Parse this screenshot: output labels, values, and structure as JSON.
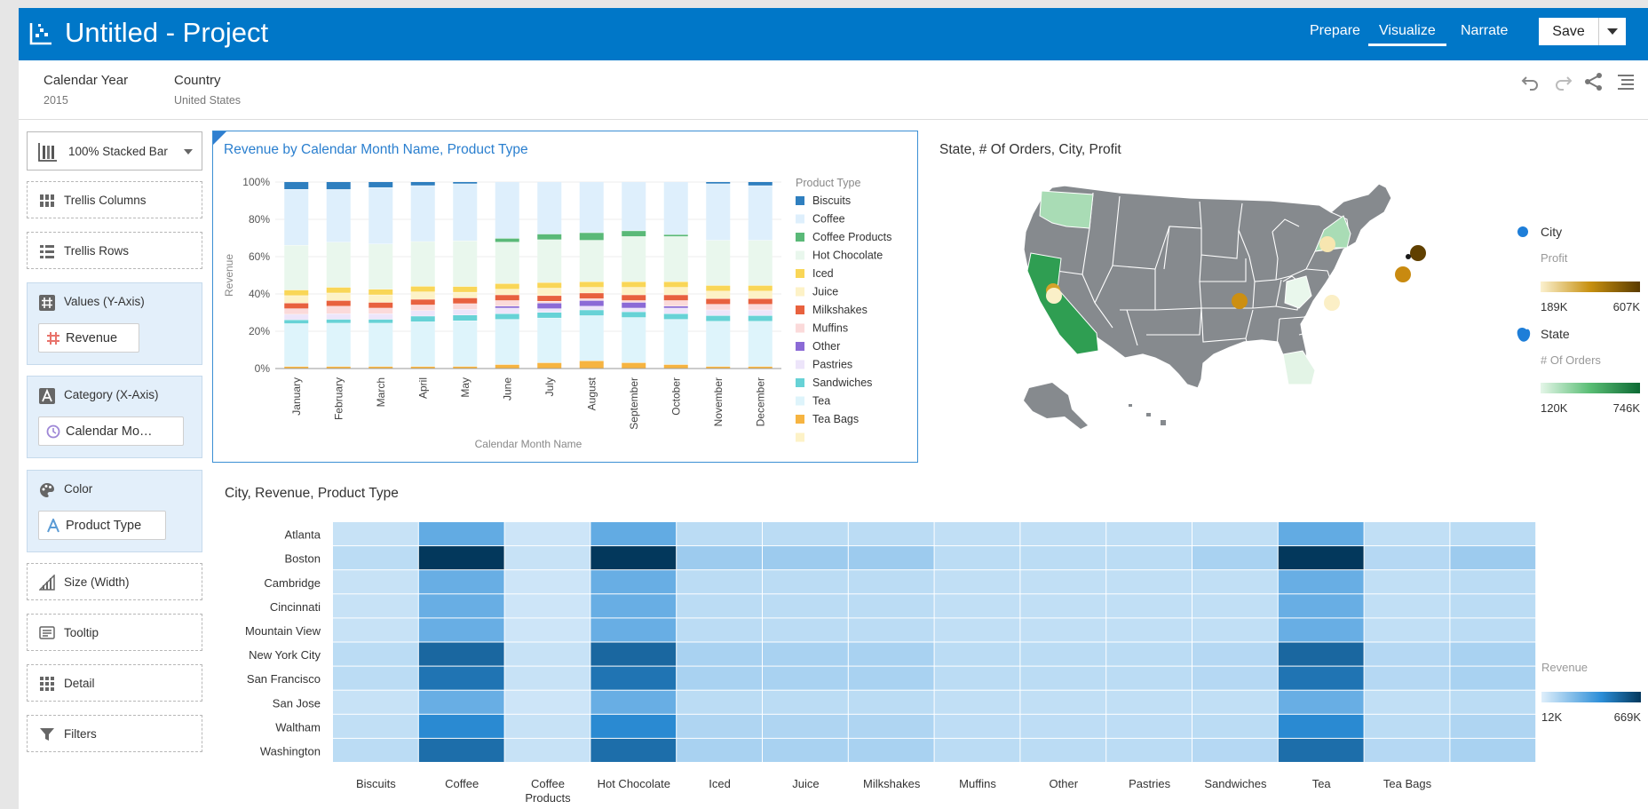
{
  "header": {
    "title": "Untitled - Project",
    "tabs": [
      "Prepare",
      "Visualize",
      "Narrate"
    ],
    "active_tab": "Visualize",
    "save_label": "Save"
  },
  "filters": [
    {
      "name": "Calendar Year",
      "value": "2015"
    },
    {
      "name": "Country",
      "value": "United States"
    }
  ],
  "grammar": {
    "viz_type": "100% Stacked Bar",
    "trellis_columns": "Trellis Columns",
    "trellis_rows": "Trellis Rows",
    "values_label": "Values (Y-Axis)",
    "values_item": "Revenue",
    "category_label": "Category (X-Axis)",
    "category_item": "Calendar Mo…",
    "color_label": "Color",
    "color_item": "Product Type",
    "size_label": "Size (Width)",
    "tooltip_label": "Tooltip",
    "detail_label": "Detail",
    "filters_label": "Filters"
  },
  "colors": {
    "accent": "#0077c8",
    "map_land": "#868a8e"
  },
  "bar_chart": {
    "title": "Revenue by Calendar Month Name, Product Type",
    "legend_title": "Product Type"
  },
  "chart_data": [
    {
      "type": "bar",
      "stacked_percent": true,
      "title": "Revenue by Calendar Month Name, Product Type",
      "xlabel": "Calendar Month Name",
      "ylabel": "Revenue",
      "ylim": [
        0,
        100
      ],
      "yticks": [
        "0%",
        "20%",
        "40%",
        "60%",
        "80%",
        "100%"
      ],
      "categories": [
        "January",
        "February",
        "March",
        "April",
        "May",
        "June",
        "July",
        "August",
        "September",
        "October",
        "November",
        "December"
      ],
      "legend": "right",
      "series": [
        {
          "name": "Tea Bags",
          "color": "#f6b441",
          "values": [
            1,
            1,
            1,
            1,
            1,
            2,
            3,
            4,
            3,
            2,
            1,
            1
          ]
        },
        {
          "name": "Tea",
          "color": "#def4fb",
          "values": [
            23,
            23,
            23,
            24,
            24,
            24,
            24,
            24,
            24,
            24,
            24,
            24
          ]
        },
        {
          "name": "Sandwiches",
          "color": "#67d2d6",
          "values": [
            2,
            2,
            2,
            3,
            3,
            3,
            3,
            3,
            3,
            3,
            3,
            3
          ]
        },
        {
          "name": "Pastries",
          "color": "#ede5fa",
          "values": [
            3,
            3,
            3,
            3,
            3,
            3,
            2,
            2,
            2,
            3,
            3,
            3
          ]
        },
        {
          "name": "Other",
          "color": "#8b6ad6",
          "values": [
            0,
            0,
            0,
            0,
            0,
            1,
            3,
            3,
            3,
            1,
            0,
            0
          ]
        },
        {
          "name": "Muffins",
          "color": "#fbdada",
          "values": [
            3,
            4,
            3,
            3,
            3,
            3,
            1,
            1,
            1,
            3,
            3,
            3
          ]
        },
        {
          "name": "Milkshakes",
          "color": "#e8613e",
          "values": [
            3,
            3,
            3,
            3,
            3,
            3,
            3,
            3,
            3,
            3,
            3,
            3
          ]
        },
        {
          "name": "Juice",
          "color": "#fdf2c7",
          "values": [
            4,
            4,
            4,
            4,
            3,
            3,
            4,
            3,
            4,
            4,
            4,
            4
          ]
        },
        {
          "name": "Iced",
          "color": "#f9d657",
          "values": [
            3,
            3,
            3,
            3,
            3,
            3,
            3,
            3,
            3,
            3,
            3,
            3
          ]
        },
        {
          "name": "Hot Chocolate",
          "color": "#e9f7ed",
          "values": [
            24,
            24,
            24,
            24,
            24,
            22,
            23,
            22,
            24,
            24,
            24,
            24
          ]
        },
        {
          "name": "Coffee Products",
          "color": "#5ab978",
          "values": [
            0,
            0,
            0,
            0,
            0,
            2,
            3,
            4,
            3,
            1,
            0,
            0
          ]
        },
        {
          "name": "Coffee",
          "color": "#deeffc",
          "values": [
            30,
            28,
            30,
            30,
            30,
            30,
            28,
            27,
            26,
            28,
            30,
            29
          ]
        },
        {
          "name": "Biscuits",
          "color": "#2f7fbf",
          "values": [
            4,
            4,
            3,
            2,
            1,
            0,
            0,
            0,
            0,
            0,
            1,
            2
          ]
        }
      ]
    },
    {
      "type": "table",
      "title": "State, # Of Orders, City, Profit",
      "legends": [
        {
          "name": "City",
          "measure": "Profit",
          "min": "189K",
          "max": "607K",
          "colors": [
            "#fbf1cf",
            "#c79010",
            "#5a3b00"
          ]
        },
        {
          "name": "State",
          "measure": "# Of Orders",
          "min": "120K",
          "max": "746K",
          "colors": [
            "#e4f6e8",
            "#59bd74",
            "#0d6a34"
          ]
        }
      ],
      "city_points": [
        {
          "city": "San Francisco",
          "profit_level": 0.55
        },
        {
          "city": "Mountain View",
          "profit_level": 0.0
        },
        {
          "city": "San Jose",
          "profit_level": 0.1
        },
        {
          "city": "Cambridge",
          "profit_level": 0.05
        },
        {
          "city": "Cincinnati",
          "profit_level": 0.05
        },
        {
          "city": "Atlanta",
          "profit_level": 0.05
        },
        {
          "city": "Kansas City",
          "profit_level": 0.6
        },
        {
          "city": "Washington",
          "profit_level": 0.6
        },
        {
          "city": "New York City",
          "profit_level": 0.9
        },
        {
          "city": "Boston",
          "profit_level": 1.0
        }
      ],
      "state_levels": [
        {
          "state": "California",
          "orders_level": 0.8
        },
        {
          "state": "Washington",
          "orders_level": 0.3
        },
        {
          "state": "New York",
          "orders_level": 0.3
        },
        {
          "state": "Ohio",
          "orders_level": 0.05
        },
        {
          "state": "Georgia",
          "orders_level": 0.1
        },
        {
          "state": "Massachusetts",
          "orders_level": 0.2
        }
      ]
    },
    {
      "type": "heatmap",
      "title": "City, Revenue, Product Type",
      "rows": [
        "Atlanta",
        "Boston",
        "Cambridge",
        "Cincinnati",
        "Mountain View",
        "New York City",
        "San Francisco",
        "San Jose",
        "Waltham",
        "Washington"
      ],
      "columns": [
        "Biscuits",
        "Coffee",
        "Coffee Products",
        "Hot Chocolate",
        "Iced",
        "Juice",
        "Milkshakes",
        "Muffins",
        "Other",
        "Pastries",
        "Sandwiches",
        "Tea",
        "Tea Bags",
        ""
      ],
      "value_label": "Revenue",
      "min_label": "12K",
      "max_label": "669K",
      "values": [
        [
          0.08,
          0.42,
          0.06,
          0.42,
          0.12,
          0.12,
          0.12,
          0.1,
          0.1,
          0.1,
          0.1,
          0.42,
          0.1,
          0.12
        ],
        [
          0.12,
          1.0,
          0.08,
          1.0,
          0.22,
          0.22,
          0.22,
          0.12,
          0.12,
          0.12,
          0.18,
          1.0,
          0.14,
          0.22
        ],
        [
          0.08,
          0.4,
          0.06,
          0.4,
          0.12,
          0.12,
          0.12,
          0.1,
          0.1,
          0.1,
          0.1,
          0.4,
          0.1,
          0.12
        ],
        [
          0.08,
          0.4,
          0.06,
          0.4,
          0.12,
          0.12,
          0.12,
          0.1,
          0.1,
          0.1,
          0.1,
          0.4,
          0.1,
          0.12
        ],
        [
          0.08,
          0.4,
          0.06,
          0.4,
          0.12,
          0.12,
          0.12,
          0.1,
          0.1,
          0.1,
          0.1,
          0.4,
          0.1,
          0.12
        ],
        [
          0.12,
          0.78,
          0.08,
          0.78,
          0.18,
          0.18,
          0.18,
          0.12,
          0.12,
          0.12,
          0.14,
          0.78,
          0.14,
          0.18
        ],
        [
          0.12,
          0.72,
          0.08,
          0.72,
          0.18,
          0.18,
          0.18,
          0.12,
          0.12,
          0.12,
          0.14,
          0.72,
          0.14,
          0.18
        ],
        [
          0.08,
          0.4,
          0.06,
          0.4,
          0.12,
          0.12,
          0.12,
          0.1,
          0.1,
          0.1,
          0.1,
          0.4,
          0.1,
          0.12
        ],
        [
          0.1,
          0.62,
          0.08,
          0.62,
          0.16,
          0.16,
          0.16,
          0.11,
          0.11,
          0.11,
          0.12,
          0.62,
          0.12,
          0.16
        ],
        [
          0.12,
          0.75,
          0.08,
          0.75,
          0.18,
          0.18,
          0.18,
          0.12,
          0.12,
          0.12,
          0.14,
          0.75,
          0.14,
          0.18
        ]
      ]
    }
  ]
}
